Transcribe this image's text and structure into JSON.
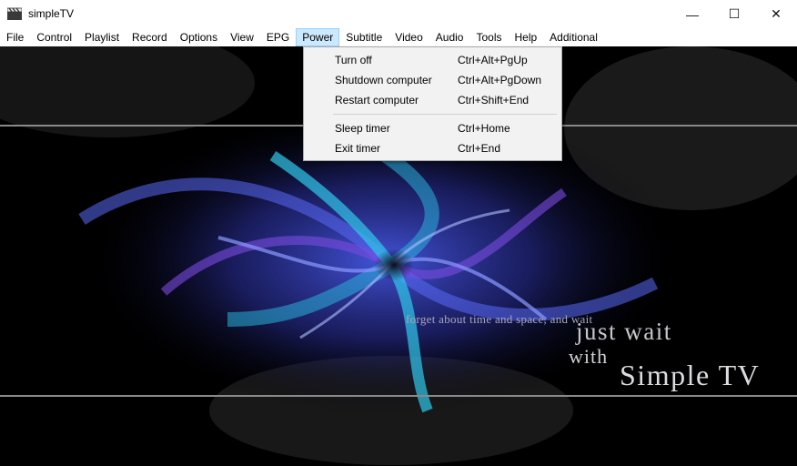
{
  "window": {
    "title": "simpleTV",
    "controls": {
      "minimize": "—",
      "maximize": "☐",
      "close": "✕"
    }
  },
  "menubar": {
    "items": [
      "File",
      "Control",
      "Playlist",
      "Record",
      "Options",
      "View",
      "EPG",
      "Power",
      "Subtitle",
      "Video",
      "Audio",
      "Tools",
      "Help",
      "Additional"
    ],
    "active": "Power"
  },
  "power_menu": {
    "items": [
      {
        "label": "Turn off",
        "shortcut": "Ctrl+Alt+PgUp"
      },
      {
        "label": "Shutdown computer",
        "shortcut": "Ctrl+Alt+PgDown"
      },
      {
        "label": "Restart computer",
        "shortcut": "Ctrl+Shift+End"
      },
      {
        "label": "Sleep timer",
        "shortcut": "Ctrl+Home"
      },
      {
        "label": "Exit timer",
        "shortcut": "Ctrl+End"
      }
    ]
  },
  "video": {
    "overlay_line1": "forget about time and space, and wait",
    "overlay_line2": "just wait",
    "overlay_line3": "with",
    "overlay_line4": "Simple TV"
  },
  "colors": {
    "menu_highlight": "#cce8ff",
    "swirl_blue": "#3b4fe0",
    "swirl_cyan": "#2ec7e8",
    "swirl_purple": "#6a2bd0"
  },
  "icons": {
    "app": "clapperboard-icon"
  }
}
